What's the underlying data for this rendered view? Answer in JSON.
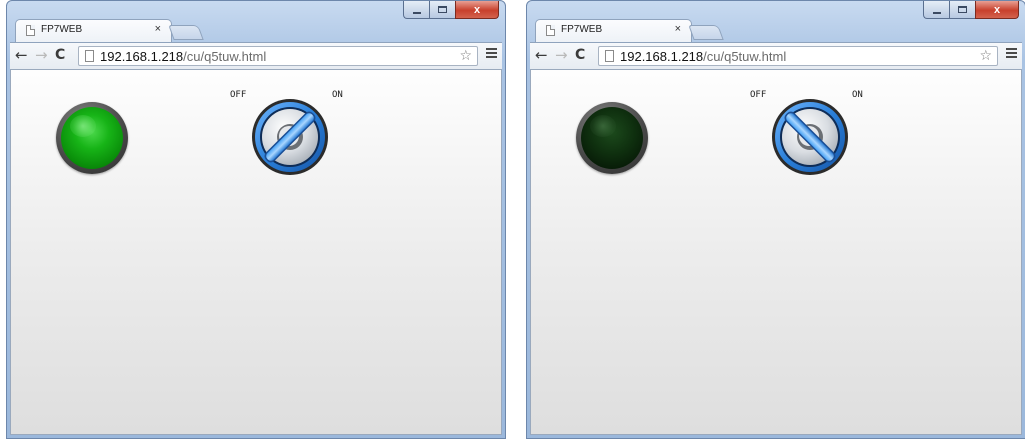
{
  "windows": [
    {
      "tab_title": "FP7WEB",
      "tab_close": "×",
      "url_host": "192.168.1.218",
      "url_path": "/cu/q5tuw.html",
      "lamp": {
        "state": "on",
        "color": "#17b417"
      },
      "switch": {
        "off_label": "OFF",
        "on_label": "ON",
        "accent_color": "#3b8fe0"
      }
    },
    {
      "tab_title": "FP7WEB",
      "tab_close": "×",
      "url_host": "192.168.1.218",
      "url_path": "/cu/q5tuw.html",
      "lamp": {
        "state": "off",
        "color": "#0f300f"
      },
      "switch": {
        "off_label": "OFF",
        "on_label": "ON",
        "accent_color": "#3b8fe0"
      }
    }
  ],
  "window_controls": {
    "close_glyph": "x"
  },
  "icons": {
    "back": "←",
    "forward": "→",
    "reload": "C",
    "star": "☆"
  }
}
